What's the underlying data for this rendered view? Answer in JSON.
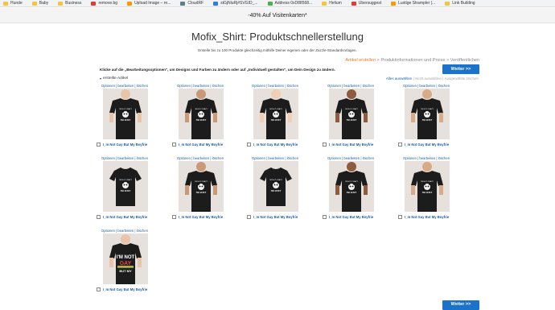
{
  "bookmarks": [
    {
      "label": "Hunde",
      "icon": "folder-icon"
    },
    {
      "label": "Baby",
      "icon": "folder-icon"
    },
    {
      "label": "Business",
      "icon": "folder-icon"
    },
    {
      "label": "remove.bg",
      "icon": "site-icon"
    },
    {
      "label": "Upload Image – re...",
      "icon": "site-icon"
    },
    {
      "label": "CloudRF",
      "icon": "site-icon"
    },
    {
      "label": "stGjNluRj#SVGID_...",
      "icon": "site-icon"
    },
    {
      "label": "Address 0xD88568...",
      "icon": "site-icon"
    },
    {
      "label": "Helium",
      "icon": "folder-icon"
    },
    {
      "label": "Ubersuggest",
      "icon": "site-icon"
    },
    {
      "label": "Lustige Strampler |...",
      "icon": "site-icon"
    },
    {
      "label": "Link Building",
      "icon": "folder-icon"
    }
  ],
  "promo": "-40% Auf Visitenkarten*",
  "page": {
    "title": "Mofix_Shirt: Produktschnellerstellung",
    "subtitle": "Erstelle bis zu 100 Produkte gleichzeitig mithilfe Deiner eigenen oder der Zazzle-Standardvorlagen.",
    "steps": {
      "step1": "Artikel erstellen",
      "sep": " > ",
      "step2": "Produktinformationen und Preise",
      "step3": "Veröffentlichen"
    },
    "instruction": "Klicke auf die „Bearbeitungsoptionen\", um Designs und Farben zu ändern oder auf „Individuell gestalten\", um Dein Design zu ändern.",
    "next_label": "Weiter >>",
    "created_label": "erstellte Artikel",
    "select_all": "Alles auswählen",
    "select_sep": " | ",
    "deselect_all": "Nicht auswählen",
    "selected_remove": "Ausgewählte löschen"
  },
  "products": [
    {
      "options": "Optionen | bearbeiten | löschen",
      "name": "I_m Not Gay But My Boyfrie",
      "style": "model-female"
    },
    {
      "options": "Optionen | bearbeiten | löschen",
      "name": "I_m Not Gay But My Boyfrie",
      "style": "model-female"
    },
    {
      "options": "Optionen | bearbeiten | löschen",
      "name": "I_m Not Gay But My Boyfrie",
      "style": "model-female"
    },
    {
      "options": "Optionen | bearbeiten | löschen",
      "name": "I_m Not Gay But My Boyfrie",
      "style": "model-male"
    },
    {
      "options": "Optionen | bearbeiten | löschen",
      "name": "I_m Not Gay But My Boyfrie",
      "style": "model-female"
    },
    {
      "options": "Optionen | bearbeiten | löschen",
      "name": "I_m Not Gay But My Boyfrie",
      "style": "flat"
    },
    {
      "options": "Optionen | bearbeiten | löschen",
      "name": "I_m Not Gay But My Boyfrie",
      "style": "model-female"
    },
    {
      "options": "Optionen | bearbeiten | löschen",
      "name": "I_m Not Gay But My Boyfrie",
      "style": "flat"
    },
    {
      "options": "Optionen | bearbeiten | löschen",
      "name": "I_m Not Gay But My Boyfrie",
      "style": "model-male"
    },
    {
      "options": "Optionen | bearbeiten | löschen",
      "name": "I_m Not Gay But My Boyfrie",
      "style": "model-male"
    },
    {
      "options": "Optionen | bearbeiten | löschen",
      "name": "I_m Not Gay But My Boyfrie",
      "style": "text-design"
    }
  ],
  "design_texts": {
    "panda_line1": "I'M NOT CRAZY",
    "panda_line2": "I'M JUST",
    "text_line1": "I'M NOT",
    "text_line2": "GAY",
    "text_line3": "BUT MY"
  },
  "colors": {
    "accent_blue": "#1a73c9",
    "link_blue": "#1a5fa8",
    "active_step": "#e8772e",
    "shirt": "#1c1c1c",
    "thumb_bg": "#e6e1dc"
  }
}
